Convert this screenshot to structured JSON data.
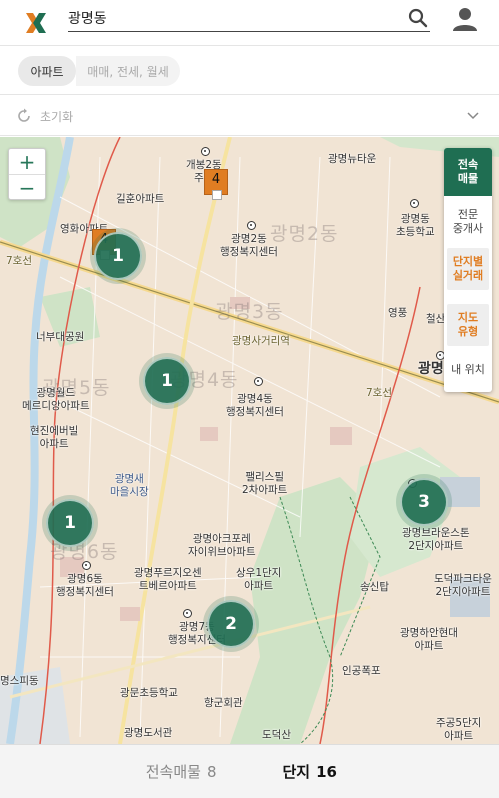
{
  "header": {
    "search_value": "광명동",
    "logo_icon": "x-logo-icon",
    "search_icon": "search-icon",
    "user_icon": "user-icon"
  },
  "filters": {
    "property_type": "아파트",
    "deal_type_placeholder": "매매, 전세, 월세",
    "reset_label": "초기화"
  },
  "map": {
    "zoom_in": "+",
    "zoom_out": "−",
    "dong_labels": {
      "d2": "광명2동",
      "d3": "광명3동",
      "d4": "광명4동",
      "d5": "광명5동",
      "d6": "광명6동"
    },
    "places": {
      "gaebong": "개봉2동\n주민",
      "gwangmyeong_newtown": "광명뉴타운",
      "gilhun": "길훈아파트",
      "yeonghwa": "영화아파트",
      "d2_center": "광명2동\n행정복지센터",
      "d2_school": "광명동\n초등학교",
      "d4_center": "광명4동\n행정복지센터",
      "d6_center": "광명6동\n행정복지센터",
      "d7_center": "광명7동\n행정복지센터",
      "neobu": "너부대공원",
      "gm_world": "광명월드\n메르디앙아파트",
      "hyunjin": "현진에버빌\n아파트",
      "market": "광명새\n마을시장",
      "palace": "팰리스필\n2차아파트",
      "xi": "광명아크포레\n자이위브아파트",
      "prugio": "광명푸르지오센\n트베르아파트",
      "sangwoo": "상우1단지\n아파트",
      "sari": "광명사거리역",
      "line7": "7호선",
      "songsin": "송신탑",
      "brown": "광명브라운스톤\n2단지아파트",
      "dodeok": "도덕파크타운\n2단지아파트",
      "hyundai": "광명하안현대\n아파트",
      "ingong": "인공폭포",
      "hyanggun": "향군회관",
      "gwangmun": "광문초등학교",
      "library": "광명도서관",
      "dodeoksan": "도덕산",
      "jugong": "주공5단지\n아파트",
      "pidong": "명스피동",
      "gwangmyeong_edge": "광명",
      "yeongpung": "영풍",
      "cheolsan": "철산"
    },
    "clusters": [
      {
        "id": "c1",
        "count": "1"
      },
      {
        "id": "c2",
        "count": "1"
      },
      {
        "id": "c3",
        "count": "1"
      },
      {
        "id": "c4",
        "count": "2"
      },
      {
        "id": "c5",
        "count": "3"
      }
    ],
    "listings": [
      {
        "id": "l1",
        "count": "4"
      },
      {
        "id": "l2",
        "count": "4"
      }
    ]
  },
  "right_panel": {
    "exclusive": "전속\n매물",
    "agent": "전문\n중개사",
    "complex_price": "단지별\n실거래",
    "map_type": "지도\n유형",
    "my_location": "내 위치"
  },
  "tabs": {
    "exclusive_label": "전속매물",
    "exclusive_count": "8",
    "complex_label": "단지",
    "complex_count": "16"
  },
  "colors": {
    "brand_green": "#1f6e52",
    "accent_orange": "#e07d22",
    "map_bg": "#f1e4d4"
  }
}
